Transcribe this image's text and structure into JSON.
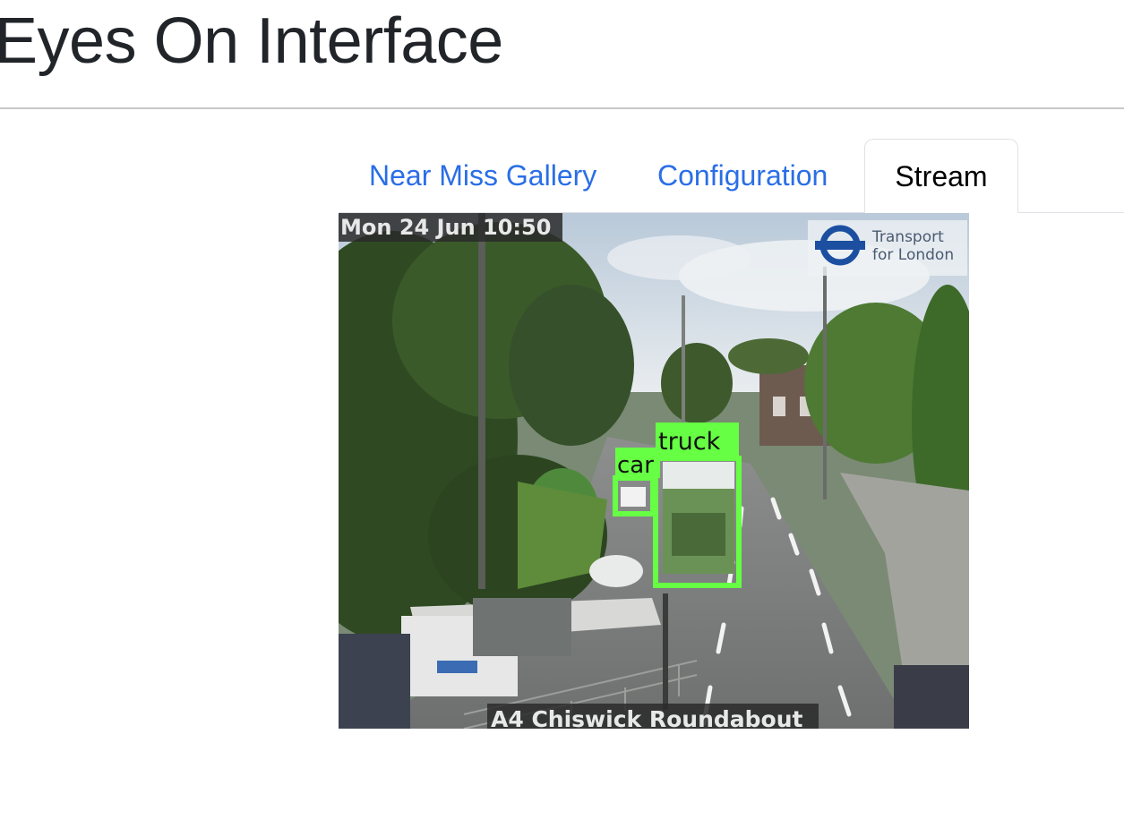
{
  "app": {
    "title": "Eyes On Interface"
  },
  "tabs": [
    {
      "label": "Near Miss Gallery",
      "active": false
    },
    {
      "label": "Configuration",
      "active": false
    },
    {
      "label": "Stream",
      "active": true
    }
  ],
  "stream": {
    "timestamp": "Mon 24 Jun 10:50",
    "location": "A4 Chiswick Roundabout",
    "provider_line1": "Transport",
    "provider_line2": "for London",
    "detections": [
      {
        "label": "truck"
      },
      {
        "label": "car"
      }
    ],
    "detection_color": "#66ff44"
  },
  "colors": {
    "link": "#2a6ee6",
    "title": "#212529"
  }
}
